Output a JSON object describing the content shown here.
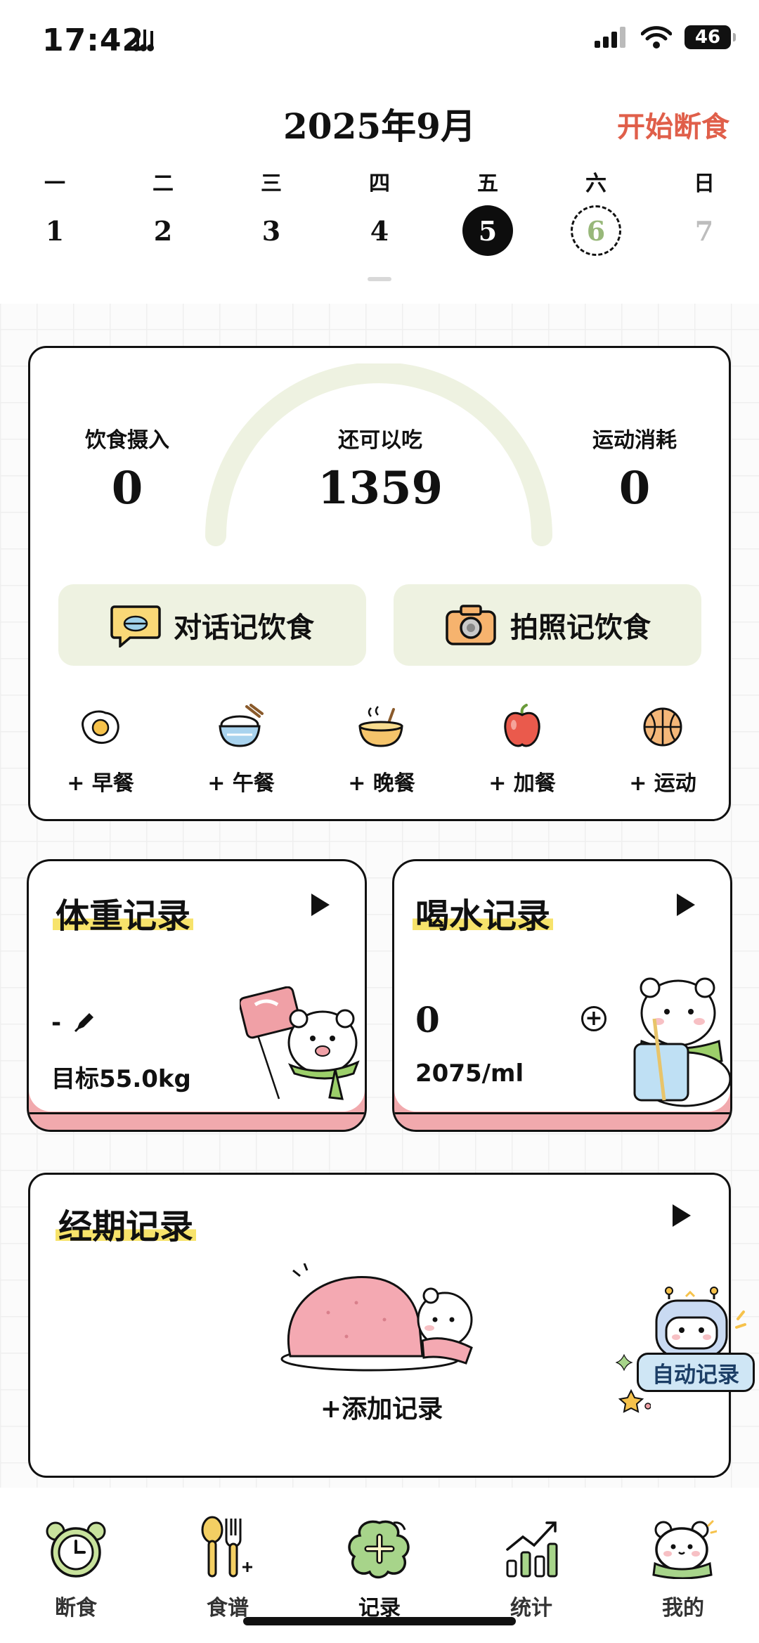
{
  "status_bar": {
    "time": "17:42",
    "extra": "",
    "battery": "46"
  },
  "header": {
    "month_title": "2025年9月",
    "start_fasting": "开始断食"
  },
  "week": {
    "labels": [
      "一",
      "二",
      "三",
      "四",
      "五",
      "六",
      "日"
    ],
    "days": [
      "1",
      "2",
      "3",
      "4",
      "5",
      "6",
      "7"
    ]
  },
  "summary": {
    "intake_label": "饮食摄入",
    "intake_value": "0",
    "remaining_label": "还可以吃",
    "remaining_value": "1359",
    "burned_label": "运动消耗",
    "burned_value": "0",
    "chat_log_label": "对话记饮食",
    "photo_log_label": "拍照记饮食",
    "meals": [
      "+ 早餐",
      "+ 午餐",
      "+ 晚餐",
      "+ 加餐",
      "+ 运动"
    ]
  },
  "weight": {
    "title": "体重记录",
    "value": "-",
    "target": "目标55.0kg"
  },
  "water": {
    "title": "喝水记录",
    "value": "0",
    "goal": "2075/ml",
    "add_symbol": "+"
  },
  "period": {
    "title": "经期记录",
    "add_record": "+添加记录"
  },
  "auto_record": {
    "label": "自动记录"
  },
  "nav": {
    "items": [
      "断食",
      "食谱",
      "记录",
      "统计",
      "我的"
    ]
  },
  "colors": {
    "accent_red": "#e05f4a",
    "soft_green": "#eef2e1",
    "card_pink": "#f1a9ad",
    "highlight_yellow": "#f7e36b",
    "today_green": "#98b87a"
  }
}
